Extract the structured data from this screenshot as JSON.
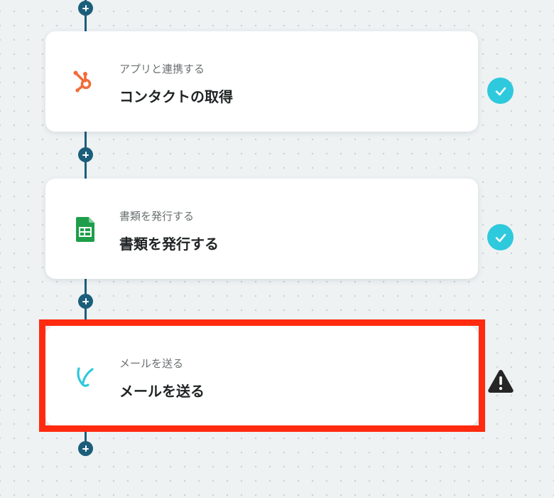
{
  "flow": {
    "steps": [
      {
        "subtitle": "アプリと連携する",
        "title": "コンタクトの取得",
        "app_icon": "hubspot-icon",
        "status": "completed",
        "status_icon": "check-circle-icon"
      },
      {
        "subtitle": "書類を発行する",
        "title": "書類を発行する",
        "app_icon": "google-sheets-icon",
        "status": "completed",
        "status_icon": "check-circle-icon"
      },
      {
        "subtitle": "メールを送る",
        "title": "メールを送る",
        "app_icon": "yoom-mail-icon",
        "status": "warning",
        "status_icon": "warning-triangle-icon",
        "highlighted": true
      }
    ],
    "add_step_icon": "plus-icon"
  },
  "colors": {
    "background": "#eef2f3",
    "connector": "#1b5e7a",
    "card": "#ffffff",
    "status_ok": "#2ec9dc",
    "status_warning": "#262626",
    "highlight": "#ff2a0f",
    "hubspot": "#f26b3a",
    "sheets": "#1e9e4a",
    "mail": "#2ec9dc"
  }
}
